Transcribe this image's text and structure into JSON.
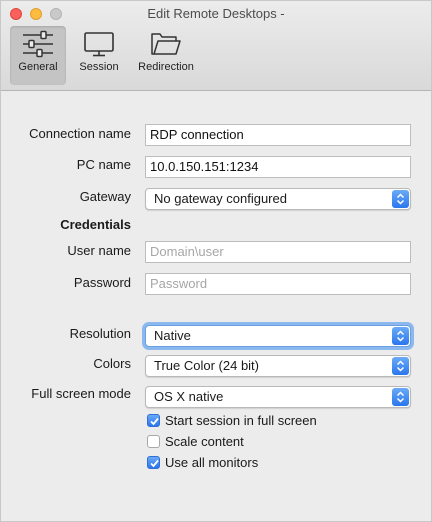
{
  "window": {
    "title": "Edit Remote Desktops -"
  },
  "toolbar": {
    "items": [
      {
        "label": "General",
        "icon": "sliders-icon",
        "selected": true
      },
      {
        "label": "Session",
        "icon": "monitor-icon",
        "selected": false
      },
      {
        "label": "Redirection",
        "icon": "folder-icon",
        "selected": false
      }
    ]
  },
  "form": {
    "connection_name": {
      "label": "Connection name",
      "value": "RDP connection"
    },
    "pc_name": {
      "label": "PC name",
      "value": "10.0.150.151:1234"
    },
    "gateway": {
      "label": "Gateway",
      "value": "No gateway configured"
    },
    "credentials_heading": "Credentials",
    "user_name": {
      "label": "User name",
      "placeholder": "Domain\\user"
    },
    "password": {
      "label": "Password",
      "placeholder": "Password"
    },
    "resolution": {
      "label": "Resolution",
      "value": "Native"
    },
    "colors": {
      "label": "Colors",
      "value": "True Color (24 bit)"
    },
    "full_screen_mode": {
      "label": "Full screen mode",
      "value": "OS X native"
    },
    "checkboxes": [
      {
        "label": "Start session in full screen",
        "checked": true
      },
      {
        "label": "Scale content",
        "checked": false
      },
      {
        "label": "Use all monitors",
        "checked": true
      }
    ]
  },
  "colors": {
    "accent": "#2a76ee",
    "selected_tab_bg": "#c4c4c4"
  }
}
